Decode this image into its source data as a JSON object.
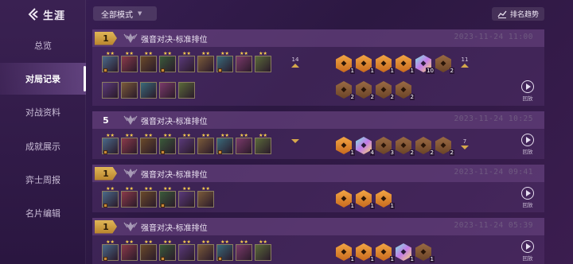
{
  "sidebar": {
    "title": "生涯",
    "items": [
      {
        "label": "总览",
        "active": false
      },
      {
        "label": "对局记录",
        "active": true
      },
      {
        "label": "对战资料",
        "active": false
      },
      {
        "label": "成就展示",
        "active": false
      },
      {
        "label": "弈士周报",
        "active": false
      },
      {
        "label": "名片编辑",
        "active": false
      }
    ]
  },
  "toolbar": {
    "mode_select": "全部模式",
    "trend_button": "排名趋势"
  },
  "replay_label": "回放",
  "matches": [
    {
      "rank": "1",
      "mode": "强音对决-标准排位",
      "datetime": "2023-11-24 11:00",
      "level": "14",
      "trend": "up",
      "units_row1": 9,
      "units_row2": 5,
      "traits_row1": [
        {
          "tier": "gold",
          "count": "1"
        },
        {
          "tier": "gold",
          "count": "1"
        },
        {
          "tier": "gold",
          "count": "1"
        },
        {
          "tier": "gold",
          "count": "1"
        },
        {
          "tier": "prism",
          "count": "10"
        },
        {
          "tier": "bronze",
          "count": "2"
        }
      ],
      "traits_row2": [
        {
          "tier": "bronze",
          "count": "2"
        },
        {
          "tier": "bronze",
          "count": "2"
        },
        {
          "tier": "bronze",
          "count": "2"
        },
        {
          "tier": "bronze",
          "count": "2"
        }
      ],
      "traits_extra": "11"
    },
    {
      "rank": "5",
      "mode": "强音对决-标准排位",
      "datetime": "2023-11-24 10:25",
      "level": "",
      "trend": "down",
      "units_row1": 9,
      "units_row2": 0,
      "traits_row1": [
        {
          "tier": "gold",
          "count": "1"
        },
        {
          "tier": "prism",
          "count": "4"
        },
        {
          "tier": "bronze",
          "count": "3"
        },
        {
          "tier": "bronze",
          "count": "2"
        },
        {
          "tier": "bronze",
          "count": "2"
        },
        {
          "tier": "bronze",
          "count": "2"
        }
      ],
      "traits_row2": [],
      "traits_extra": "7"
    },
    {
      "rank": "1",
      "mode": "强音对决-标准排位",
      "datetime": "2023-11-24 09:41",
      "level": "",
      "trend": "",
      "units_row1": 6,
      "units_row2": 0,
      "traits_row1": [
        {
          "tier": "gold",
          "count": "1"
        },
        {
          "tier": "gold",
          "count": "1"
        },
        {
          "tier": "gold",
          "count": "1"
        }
      ],
      "traits_row2": [],
      "traits_extra": ""
    },
    {
      "rank": "1",
      "mode": "强音对决-标准排位",
      "datetime": "2023-11-24 05:39",
      "level": "",
      "trend": "",
      "units_row1": 9,
      "units_row2": 0,
      "traits_row1": [
        {
          "tier": "gold",
          "count": "1"
        },
        {
          "tier": "gold",
          "count": "1"
        },
        {
          "tier": "gold",
          "count": "1"
        },
        {
          "tier": "prism",
          "count": "1"
        },
        {
          "tier": "bronze",
          "count": "1"
        }
      ],
      "traits_row2": [],
      "traits_extra": ""
    }
  ],
  "colors": {
    "accent_gold": "#e0b657",
    "trait_gold": "#f2a544",
    "trait_bronze": "#9a6a43",
    "background": "#2c1842"
  }
}
